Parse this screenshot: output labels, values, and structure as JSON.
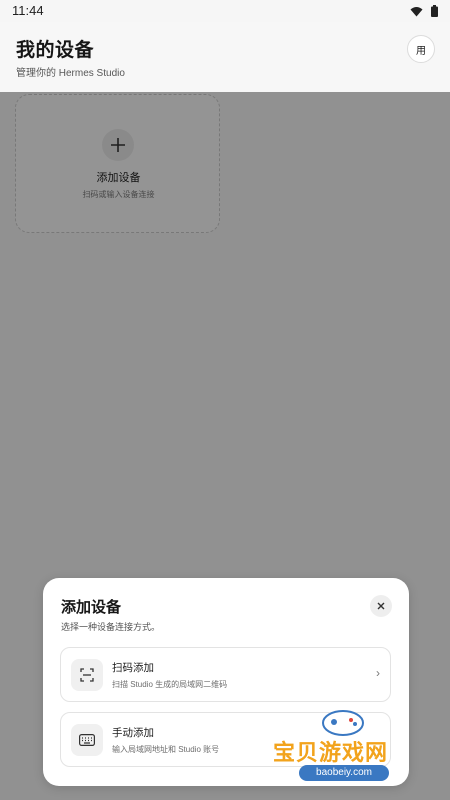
{
  "status_bar": {
    "time": "11:44",
    "icons": [
      "wifi-icon",
      "battery-icon"
    ]
  },
  "header": {
    "title": "我的设备",
    "subtitle": "管理你的 Hermes Studio",
    "avatar_label": "用"
  },
  "add_card": {
    "icon": "plus-icon",
    "title": "添加设备",
    "subtitle": "扫码或输入设备连接"
  },
  "sheet": {
    "title": "添加设备",
    "subtitle": "选择一种设备连接方式。",
    "close_icon": "close-icon",
    "options": [
      {
        "icon": "scan-icon",
        "title": "扫码添加",
        "subtitle": "扫描 Studio 生成的局域网二维码",
        "chevron": "›"
      },
      {
        "icon": "keyboard-icon",
        "title": "手动添加",
        "subtitle": "输入局域网地址和 Studio 账号"
      }
    ]
  },
  "watermark": {
    "text": "宝贝游戏网",
    "url": "baobeiy.com"
  },
  "colors": {
    "overlay": "#000000",
    "watermark": "#f2a31c",
    "watermark_url_bg": "#3a78c2"
  }
}
